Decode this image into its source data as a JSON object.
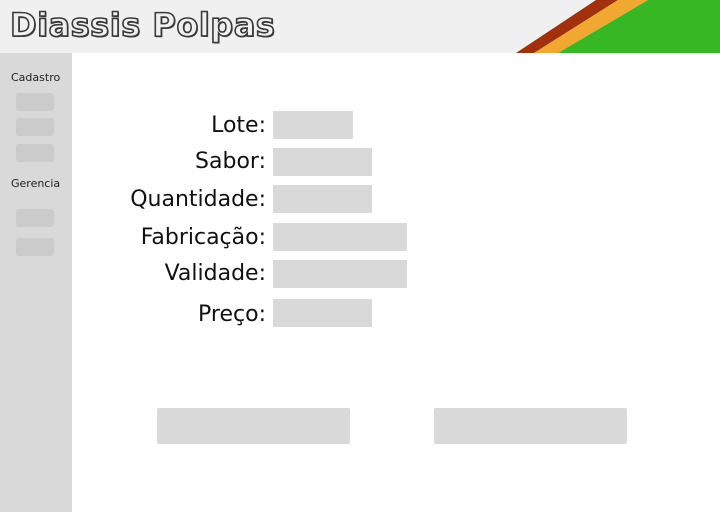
{
  "app": {
    "title": "Diassis Polpas"
  },
  "colors": {
    "stripe_red": "#a0300e",
    "stripe_orange": "#f0a830",
    "stripe_green": "#37b724"
  },
  "sidebar": {
    "sections": [
      {
        "label": "Cadastro",
        "items": [
          "",
          "",
          ""
        ]
      },
      {
        "label": "Gerencia",
        "items": [
          "",
          ""
        ]
      }
    ]
  },
  "form": {
    "fields": [
      {
        "label": "Lote:",
        "value": ""
      },
      {
        "label": "Sabor:",
        "value": ""
      },
      {
        "label": "Quantidade:",
        "value": ""
      },
      {
        "label": "Fabricação:",
        "value": ""
      },
      {
        "label": "Validade:",
        "value": ""
      },
      {
        "label": "Preço:",
        "value": ""
      }
    ]
  },
  "actions": {
    "primary_label": "",
    "secondary_label": ""
  }
}
